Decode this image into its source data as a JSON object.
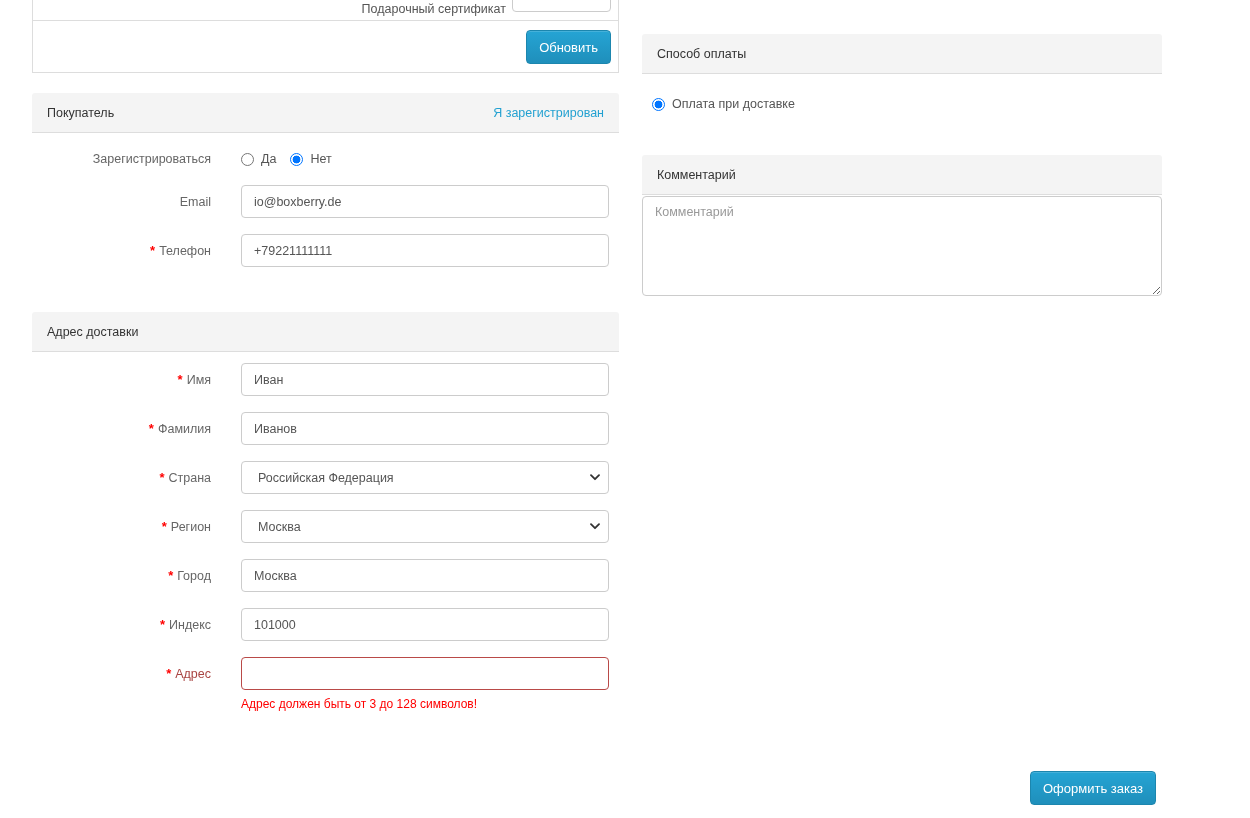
{
  "gift_certificate": {
    "label": "Подарочный сертификат",
    "update_button": "Обновить"
  },
  "customer": {
    "title": "Покупатель",
    "login_link": "Я зарегистрирован",
    "fields": [
      {
        "kind": "radio",
        "label": "Зарегистрироваться",
        "options": [
          {
            "label": "Да",
            "selected": false
          },
          {
            "label": "Нет",
            "selected": true
          }
        ]
      },
      {
        "kind": "text",
        "label": "Email",
        "value": "io@boxberry.de"
      },
      {
        "kind": "text",
        "label": "Телефон",
        "mark": "*",
        "value": "+79221111111"
      }
    ]
  },
  "shipping_address": {
    "title": "Адрес доставки",
    "fields": [
      {
        "kind": "text",
        "label": "Имя",
        "mark": "*",
        "value": "Иван"
      },
      {
        "kind": "text",
        "label": "Фамилия",
        "mark": "*",
        "value": "Иванов"
      },
      {
        "kind": "select",
        "label": "Страна",
        "mark": "*",
        "value": "Российская Федерация"
      },
      {
        "kind": "select",
        "label": "Регион",
        "mark": "*",
        "value": "Москва"
      },
      {
        "kind": "text",
        "label": "Город",
        "mark": "*",
        "value": "Москва"
      },
      {
        "kind": "text",
        "label": "Индекс",
        "mark": "*",
        "value": "101000"
      },
      {
        "kind": "text",
        "label": "Адрес",
        "mark": "*",
        "invalid": true,
        "error": "Адрес должен быть от 3 до 128 символов!"
      }
    ]
  },
  "payment_method": {
    "title": "Способ оплаты",
    "options": [
      {
        "label": "Оплата при доставке",
        "selected": true
      }
    ]
  },
  "comment": {
    "title": "Комментарий",
    "placeholder": "Комментарий"
  },
  "submit_button": "Оформить заказ"
}
